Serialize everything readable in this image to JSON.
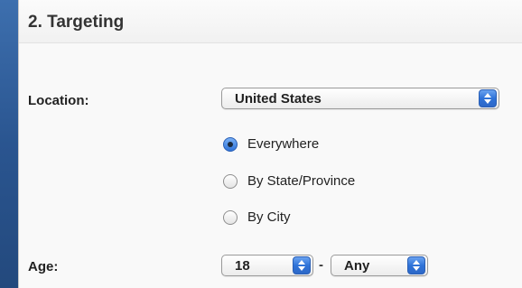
{
  "section": {
    "title": "2. Targeting"
  },
  "location": {
    "label": "Location:",
    "selected": "United States",
    "options": [
      {
        "label": "Everywhere",
        "checked": true
      },
      {
        "label": "By State/Province",
        "checked": false
      },
      {
        "label": "By City",
        "checked": false
      }
    ]
  },
  "age": {
    "label": "Age:",
    "min": "18",
    "separator": "-",
    "max": "Any"
  },
  "icons": {
    "stepper": "up-down-stepper-icon",
    "radio": "radio-button-icon"
  }
}
